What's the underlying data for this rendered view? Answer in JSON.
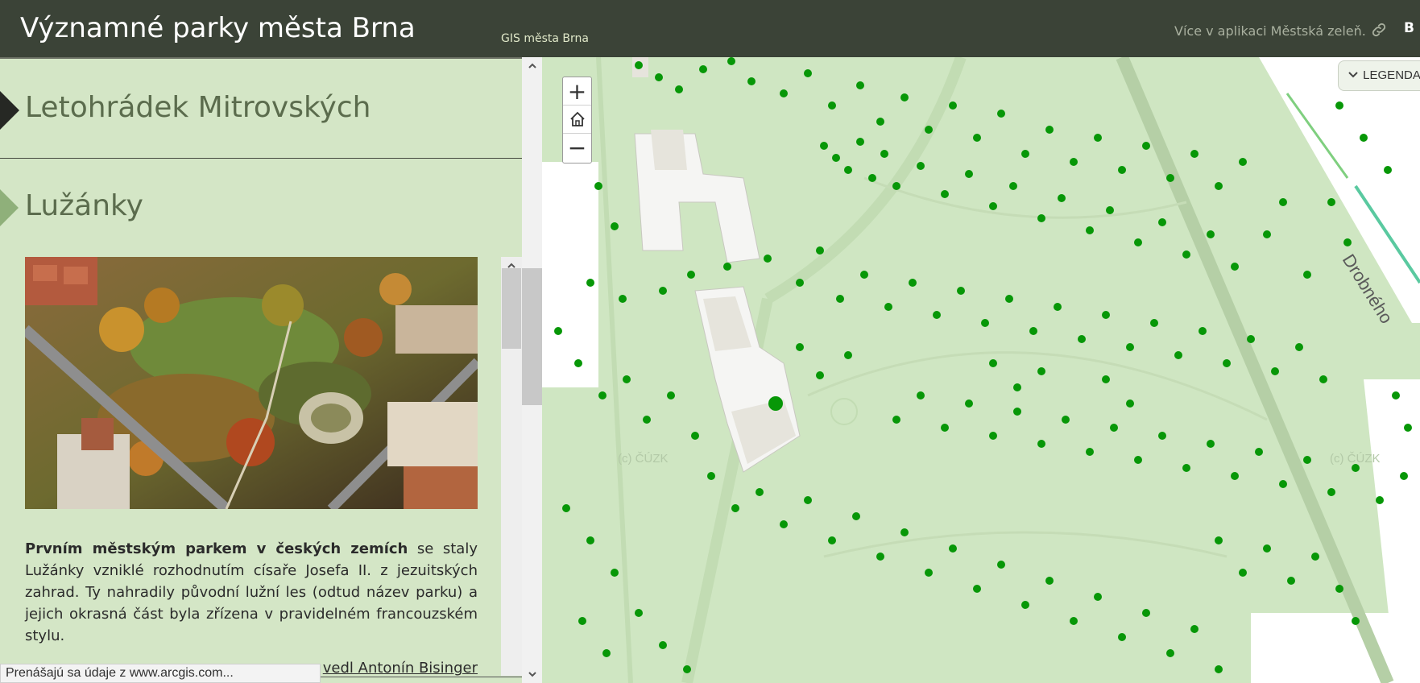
{
  "header": {
    "title": "Významné parky města Brna",
    "subtitle": "GIS města Brna",
    "more_link": "Více v aplikaci Městská zeleň.",
    "link_icon": "link-icon",
    "share_label": "B"
  },
  "panel": {
    "sections": [
      {
        "title": "Letohrádek Mitrovských",
        "active": true
      },
      {
        "title": "Lužánky",
        "active": false
      }
    ],
    "photo_alt": "aerial-park-photo",
    "paragraph_bold": "Prvním městským parkem v českých zemích",
    "paragraph_rest": " se staly Lužánky vzniklé rozhodnutím císaře Josefa II. z jezuitských zahrad. Ty nahradily původní lužní les (odtud název parku) a jejich okrasná část byla zřízena v pravidelném francouzském stylu.",
    "paragraph2_partial": "vedl Antonín Bisinger"
  },
  "status_bar": "Prenášajú sa údaje z www.arcgis.com...",
  "map": {
    "zoom_in": "+",
    "home_icon": "home-icon",
    "zoom_out": "−",
    "legend_label": "LEGENDA",
    "street_label": "Drobného",
    "watermark": "(c) ČÚZK",
    "colors": {
      "park": "#cfe6c2",
      "tree": "#079707",
      "building": "#f2f2f0"
    }
  }
}
